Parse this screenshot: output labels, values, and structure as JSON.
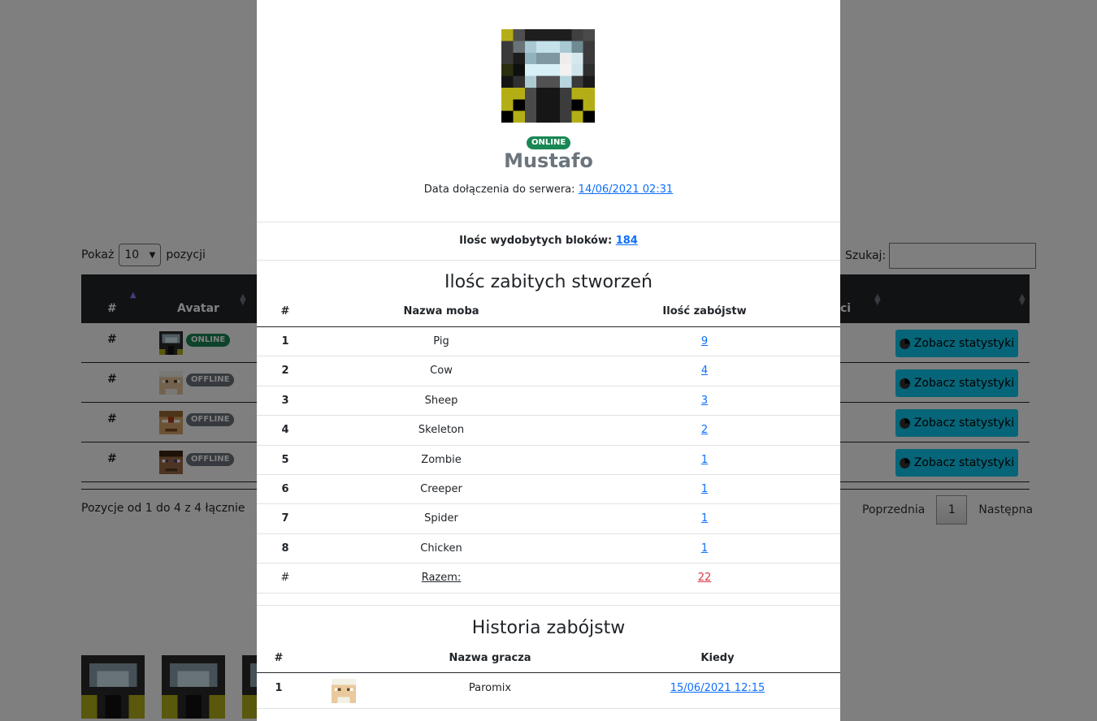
{
  "background_page": {
    "length_prefix": "Pokaż",
    "length_value": "10",
    "length_suffix": "pozycji",
    "search_label": "Szukaj:",
    "columns": [
      "#",
      "Avatar",
      "ci",
      ""
    ],
    "rows": [
      {
        "num": "#",
        "status": "ONLINE",
        "action": "Zobacz statystyki"
      },
      {
        "num": "#",
        "status": "OFFLINE",
        "action": "Zobacz statystyki"
      },
      {
        "num": "#",
        "status": "OFFLINE",
        "action": "Zobacz statystyki"
      },
      {
        "num": "#",
        "status": "OFFLINE",
        "action": "Zobacz statystyki"
      }
    ],
    "info": "Pozycje od 1 do 4 z 4 łącznie",
    "pagination": {
      "prev": "Poprzednia",
      "current": "1",
      "next": "Następna"
    }
  },
  "modal": {
    "status": "ONLINE",
    "name": "Mustafo",
    "joined_label": "Data dołączenia do serwera:",
    "joined_value": "14/06/2021 02:31",
    "blocks_label": "Ilośc wydobytych bloków:",
    "blocks_value": "184",
    "kills_title": "Ilośc zabitych stworzeń",
    "kills_headers": [
      "#",
      "Nazwa moba",
      "Ilość zabójstw"
    ],
    "kills_rows": [
      {
        "n": "1",
        "mob": "Pig",
        "count": "9"
      },
      {
        "n": "2",
        "mob": "Cow",
        "count": "4"
      },
      {
        "n": "3",
        "mob": "Sheep",
        "count": "3"
      },
      {
        "n": "4",
        "mob": "Skeleton",
        "count": "2"
      },
      {
        "n": "5",
        "mob": "Zombie",
        "count": "1"
      },
      {
        "n": "6",
        "mob": "Creeper",
        "count": "1"
      },
      {
        "n": "7",
        "mob": "Spider",
        "count": "1"
      },
      {
        "n": "8",
        "mob": "Chicken",
        "count": "1"
      }
    ],
    "kills_total": {
      "n": "#",
      "label": "Razem:",
      "count": "22"
    },
    "history_title": "Historia zabójstw",
    "history_headers": [
      "#",
      "Nazwa gracza",
      "Kiedy"
    ],
    "history_rows": [
      {
        "n": "1",
        "player": "Paromix",
        "when": "15/06/2021 12:15"
      }
    ]
  },
  "colors": {
    "online": "#198754",
    "offline": "#6c757d",
    "link": "#0d6efd",
    "total": "#dc3545",
    "button": "#0dcaf0",
    "table_head": "#212529"
  }
}
